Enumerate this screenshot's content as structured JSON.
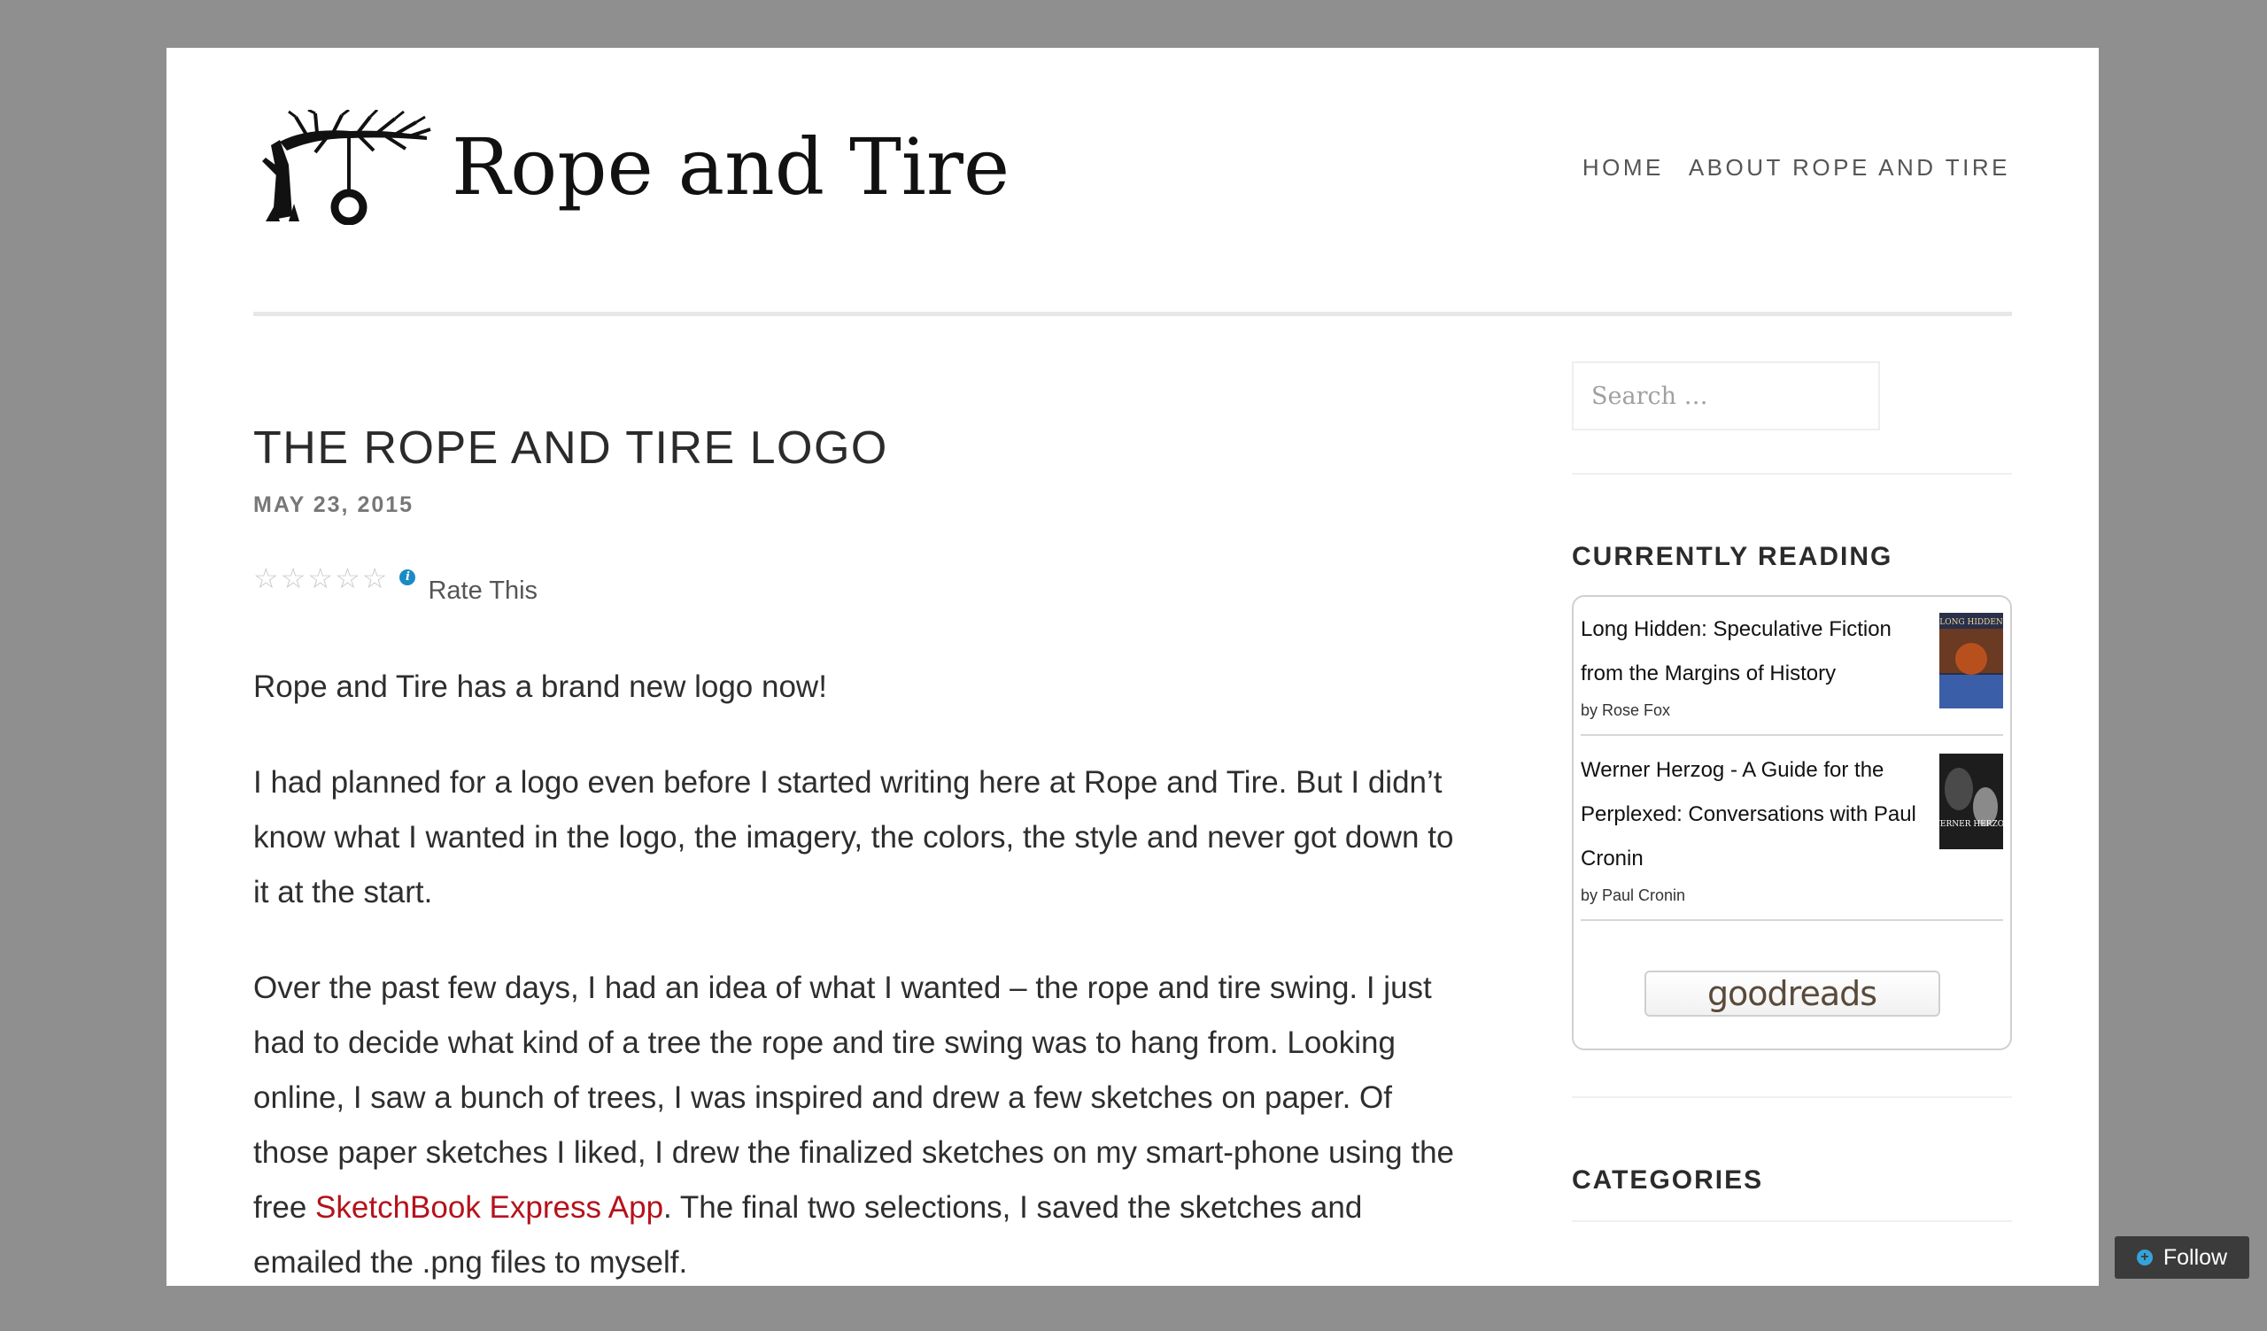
{
  "site": {
    "title": "Rope and Tire"
  },
  "nav": {
    "items": [
      {
        "label": "HOME"
      },
      {
        "label": "ABOUT ROPE AND TIRE"
      }
    ]
  },
  "post": {
    "title": "THE ROPE AND TIRE LOGO",
    "date": "MAY 23, 2015",
    "rating": {
      "label": "Rate This",
      "stars_filled": 0,
      "stars_total": 5,
      "info_icon": "info-icon"
    },
    "paragraphs": [
      {
        "text": "Rope and Tire has a brand new logo now!"
      },
      {
        "text": "I had planned for a logo even before I started writing here at Rope and Tire. But I didn’t know what I wanted in the logo, the imagery, the colors, the style and never got down to it at the start."
      },
      {
        "text_before_link": "Over the past few days, I had an idea of what I wanted – the rope and tire swing. I just had to decide what kind of a tree the rope and tire swing was to hang from. Looking online, I saw a bunch of trees, I was inspired and drew a few sketches on paper. Of those paper sketches I liked, I drew the finalized sketches on my smart-phone using the free ",
        "link_text": "SketchBook Express App",
        "text_after_link": ". The final two selections, I saved the sketches and emailed the .png files to myself."
      }
    ],
    "link_color": "#b5121b"
  },
  "sidebar": {
    "search": {
      "placeholder": "Search …"
    },
    "currently_reading": {
      "title": "CURRENTLY READING",
      "books": [
        {
          "title": "Long Hidden: Speculative Fiction from the Margins of History",
          "author": "by Rose Fox",
          "cover_text": "LONG HIDDEN"
        },
        {
          "title": "Werner Herzog - A Guide for the Perplexed: Conversations with Paul Cronin",
          "author": "by Paul Cronin",
          "cover_text": "WERNER HERZOG"
        }
      ],
      "badge": "goodreads"
    },
    "categories": {
      "title": "CATEGORIES"
    }
  },
  "follow_button": {
    "label": "Follow"
  },
  "colors": {
    "backdrop": "#8f8f8f",
    "page": "#ffffff",
    "text": "#2e2e2e",
    "accent_blue": "#1a8bc4"
  }
}
